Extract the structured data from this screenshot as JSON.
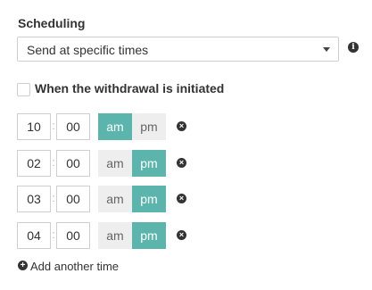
{
  "scheduling": {
    "title": "Scheduling",
    "select_value": "Send at specific times",
    "info_icon": "info-icon"
  },
  "withdrawal": {
    "label": "When the withdrawal is initiated",
    "checked": false
  },
  "times": [
    {
      "hour": "10",
      "minute": "00",
      "am_label": "am",
      "pm_label": "pm",
      "selected": "am"
    },
    {
      "hour": "02",
      "minute": "00",
      "am_label": "am",
      "pm_label": "pm",
      "selected": "pm"
    },
    {
      "hour": "03",
      "minute": "00",
      "am_label": "am",
      "pm_label": "pm",
      "selected": "pm"
    },
    {
      "hour": "04",
      "minute": "00",
      "am_label": "am",
      "pm_label": "pm",
      "selected": "pm"
    }
  ],
  "add_time": {
    "label": "Add another time",
    "icon": "plus-circle-icon"
  },
  "colors": {
    "accent": "#5bb5ad",
    "inactive": "#eeeeee",
    "border": "#cfcfcf"
  }
}
